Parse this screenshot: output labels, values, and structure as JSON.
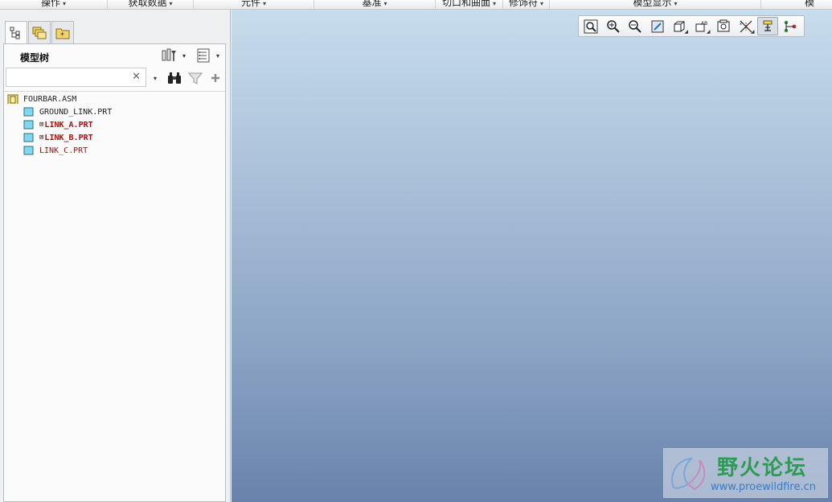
{
  "ribbon": {
    "groups": [
      {
        "label": "操作",
        "caret": "▾"
      },
      {
        "label": "获取数据",
        "caret": "▾"
      },
      {
        "label": "元件",
        "caret": "▾"
      },
      {
        "label": "基准",
        "caret": "▾"
      },
      {
        "label": "切口和曲面",
        "caret": "▾"
      },
      {
        "label": "修饰符",
        "caret": "▾"
      },
      {
        "label": "模型显示",
        "caret": "▾"
      },
      {
        "label": "模",
        "caret": ""
      }
    ]
  },
  "navigator": {
    "tabs": [
      {
        "name": "model-tree",
        "icon": "model-tree-icon",
        "active": true
      },
      {
        "name": "folder-browser",
        "icon": "folder-browser-icon",
        "active": false
      },
      {
        "name": "favorites",
        "icon": "favorites-icon",
        "active": false
      }
    ],
    "tree_title": "模型树",
    "tree_settings_icon": "tree-settings-icon",
    "tree_columns_icon": "tree-columns-icon",
    "search": {
      "value": "",
      "placeholder": "",
      "clear": "✕"
    },
    "search_dropdown_caret": "▾",
    "find_icon": "binoculars-icon",
    "filter_icon": "filter-icon",
    "add_icon": "add-icon",
    "tree": {
      "root": {
        "label": "FOURBAR.ASM",
        "icon": "assembly-icon"
      },
      "items": [
        {
          "label": "GROUND_LINK.PRT",
          "icon": "part-icon",
          "excluded": false,
          "style": "normal"
        },
        {
          "label": "LINK_A.PRT",
          "icon": "part-icon",
          "excluded": true,
          "style": "bold"
        },
        {
          "label": "LINK_B.PRT",
          "icon": "part-icon",
          "excluded": true,
          "style": "bold"
        },
        {
          "label": "LINK_C.PRT",
          "icon": "part-icon",
          "excluded": false,
          "style": "part"
        }
      ],
      "excluded_marker": "⊠"
    }
  },
  "view_toolbar": {
    "buttons": [
      {
        "name": "refit",
        "icon": "refit-icon",
        "active": false
      },
      {
        "name": "zoom-in",
        "icon": "zoom-in-icon",
        "active": false
      },
      {
        "name": "zoom-out",
        "icon": "zoom-out-icon",
        "active": false
      },
      {
        "name": "repaint",
        "icon": "repaint-icon",
        "active": false
      },
      {
        "name": "display-style",
        "icon": "display-style-icon",
        "active": false
      },
      {
        "name": "saved-orientations",
        "icon": "saved-orientations-icon",
        "active": false
      },
      {
        "name": "view-manager",
        "icon": "view-manager-icon",
        "active": false
      },
      {
        "name": "datum-display",
        "icon": "datum-display-icon",
        "active": false
      },
      {
        "name": "annotation-display",
        "icon": "annotation-display-icon",
        "active": true
      },
      {
        "name": "spin-center",
        "icon": "spin-center-icon",
        "active": false
      }
    ]
  },
  "watermark": {
    "title": "野火论坛",
    "url": "www.proewildfire.cn"
  },
  "colors": {
    "background_top": "#c7dcec",
    "background_bottom": "#6982ab",
    "part_text": "#8b1a1a",
    "watermark_title": "#2e9b55",
    "watermark_url": "#3b7cc5"
  }
}
